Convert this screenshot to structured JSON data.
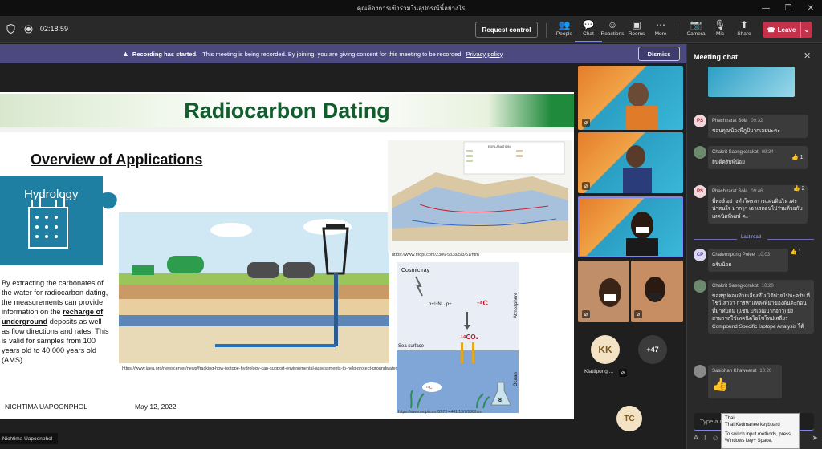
{
  "window": {
    "title": "คุณต้องการเข้าร่วมในอุปกรณ์นี้อย่างไร",
    "minimize": "—",
    "maximize": "❐",
    "close": "✕"
  },
  "toolbar": {
    "timer": "02:18:59",
    "request_control": "Request control",
    "items": [
      {
        "label": "People",
        "icon": "people-icon",
        "glyph": "👥"
      },
      {
        "label": "Chat",
        "icon": "chat-icon",
        "glyph": "💬"
      },
      {
        "label": "Reactions",
        "icon": "reactions-icon",
        "glyph": "☺"
      },
      {
        "label": "Rooms",
        "icon": "rooms-icon",
        "glyph": "▣"
      },
      {
        "label": "More",
        "icon": "more-icon",
        "glyph": "⋯"
      },
      {
        "label": "Camera",
        "icon": "camera-icon",
        "glyph": "📷"
      },
      {
        "label": "Mic",
        "icon": "mic-icon",
        "glyph": "🎙"
      },
      {
        "label": "Share",
        "icon": "share-icon",
        "glyph": "⬆"
      }
    ],
    "leave": "Leave"
  },
  "banner": {
    "bold": "Recording has started.",
    "text": "This meeting is being recorded. By joining, you are giving consent for this meeting to be recorded.",
    "link": "Privacy policy",
    "dismiss": "Dismiss"
  },
  "slide": {
    "title": "Radiocarbon Dating",
    "overview": "Overview of Applications",
    "hydrology": "Hydrology",
    "para_1": "By extracting the carbonates of the water for radiocarbon dating, the measurements can provide information on the",
    "para_hl": "recharge of underground",
    "para_2": "deposits as well as flow directions and rates. This is valid for samples from 100 years old to 40,000 years old (AMS).",
    "caption_iaea": "https://www.iaea.org/newscenter/news/fracking-how-isotope-hydrology-can-support-environmental-assessments-to-help-protect-groundwater",
    "caption_geo": "https://www.mdpi.com/2306-5338/5/3/51/htm",
    "caption_cycle": "https://www.mdpi.com/2072-4441/13/7/986/htm",
    "cosmic_ray": "Cosmic ray",
    "reaction": "n+¹⁴N→p+",
    "c14": "¹⁴C",
    "co2": "¹⁴CO₂",
    "atmosphere": "Atmosphere",
    "sea_surface": "Sea surface",
    "ocean": "Ocean",
    "fish_label": "¹⁴C",
    "flask_num": "8",
    "explanation": "EXPLANATION",
    "footer_name": "NICHTIMA UAPOONPHOL",
    "footer_date": "May 12, 2022"
  },
  "participants": {
    "kk_initials": "KK",
    "kk_name": "Kiattipong ...",
    "more_count": "+47",
    "tc_initials": "TC"
  },
  "chat": {
    "header": "Meeting chat",
    "messages": [
      {
        "initials": "PS",
        "name": "Phachirarat Sola",
        "time": "09:32",
        "text": "ชอบคุณน้องพี่ภูมิมากเลยนะคะ",
        "reaction": ""
      },
      {
        "initials": "",
        "name": "Chakrit Saengkorakot",
        "time": "09:34",
        "text": "ยินดีครับพี่น้อย",
        "reaction": "👍 1"
      },
      {
        "initials": "PS",
        "name": "Phachirarat Sola",
        "time": "09:46",
        "text": "พี่พงษ์ อย่างทำโครงการแผ่นดินไหวค่ะ น่าสนใจ มากๆๆ เอาเรดอนไปร่วมด้วยกับเทคนิคพี่พงษ์ คะ",
        "reaction": "👍 2"
      },
      {
        "initials": "CP",
        "name": "Chalermpong Polee",
        "time": "10:03",
        "text": "ครับน้อย",
        "reaction": "👍 1"
      },
      {
        "initials": "",
        "name": "Chakrit Saengkorakot",
        "time": "10:20",
        "text": "ขอสรุปตอนท้ายเลี่ยงที่ไม่ได้พ่ายไปนะครับ ที่โชว์เล่าว่า การหาแหล่งที่มาของดันตะกอน ที่มาทับถม (แช่น บริเวณปากอ่าว) ยังสามารถใช้เทคนิคไอโซโทปเสถียร Compound Specific Isotope Analysis ได้",
        "reaction": ""
      },
      {
        "initials": "",
        "name": "Sasiphan Khaweerat",
        "time": "10:20",
        "text": "👍",
        "reaction": ""
      }
    ],
    "last_read": "Last read",
    "compose_placeholder": "Type a n",
    "tooltip_line1": "Thai",
    "tooltip_line2": "Thai Kedmanee keyboard",
    "tooltip_line3": "To switch input methods, press Windows key+ Space."
  },
  "presenter_chip": "Nichtima Uapoonphol",
  "colors": {
    "leave": "#c4314b",
    "banner": "#4c4980",
    "accent": "#7f85f5"
  }
}
